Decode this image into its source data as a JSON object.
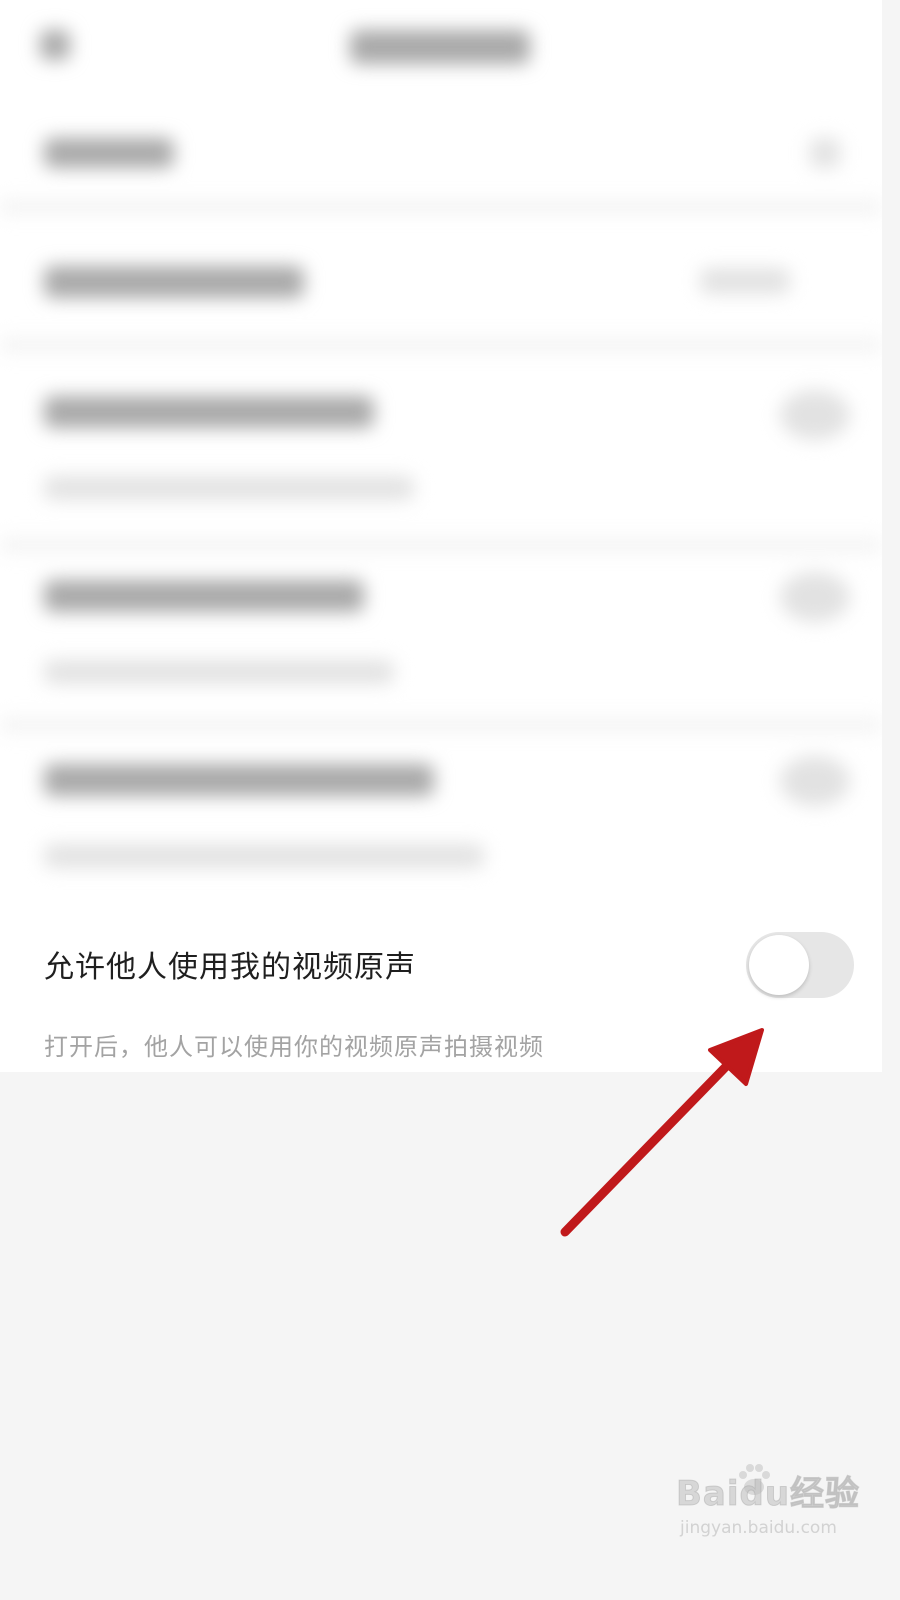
{
  "setting": {
    "title": "允许他人使用我的视频原声",
    "description": "打开后，他人可以使用你的视频原声拍摄视频",
    "toggle_enabled": false,
    "toggle_color_off": "#e6e6e6"
  },
  "annotation": {
    "arrow_color": "#c0191b"
  },
  "watermark": {
    "brand": "Baidu经验",
    "url": "jingyan.baidu.com"
  }
}
